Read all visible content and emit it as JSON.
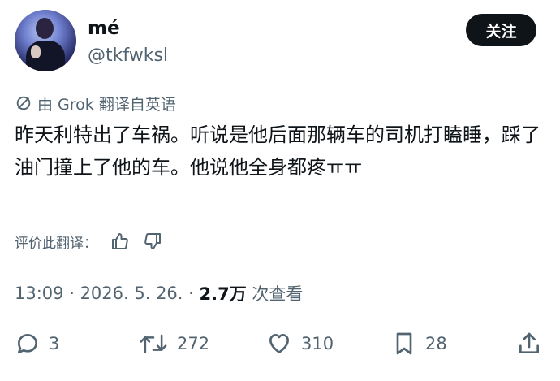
{
  "author": {
    "display_name": "mé",
    "handle": "@tkfwksl"
  },
  "follow_button": {
    "label": "关注"
  },
  "translation": {
    "label": "由 Grok 翻译自英语"
  },
  "post": {
    "text": "昨天利特出了车祸。听说是他后面那辆车的司机打瞌睡，踩了油门撞上了他的车。他说他全身都疼ㅠㅠ"
  },
  "rate_translation": {
    "label": "评价此翻译："
  },
  "meta": {
    "time": "13:09",
    "separator": " · ",
    "date": "2026. 5. 26.",
    "views_count": "2.7万",
    "views_label": " 次查看"
  },
  "actions": {
    "replies": "3",
    "reposts": "272",
    "likes": "310",
    "bookmarks": "28"
  },
  "colors": {
    "text_primary": "#0f1419",
    "text_secondary": "#536471",
    "button_bg": "#0f1419",
    "button_text": "#ffffff"
  }
}
